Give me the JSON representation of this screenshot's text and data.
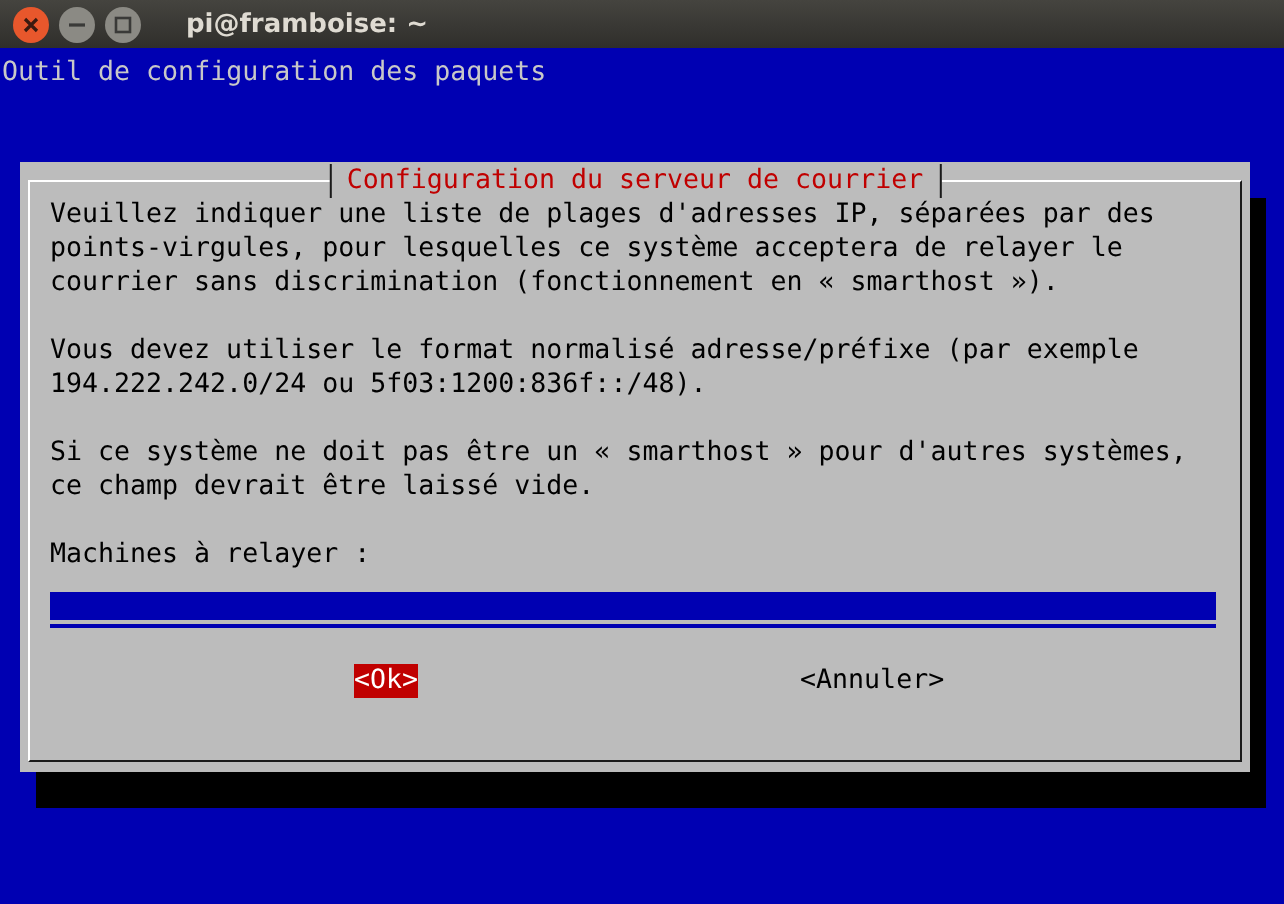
{
  "window": {
    "title": "pi@framboise: ~"
  },
  "header": "Outil de configuration des paquets",
  "dialog": {
    "title": "Configuration du serveur de courrier",
    "paragraphs": [
      [
        "Veuillez indiquer une liste de plages d'adresses IP, séparées par des",
        "points-virgules, pour lesquelles ce système acceptera de relayer le",
        "courrier sans discrimination (fonctionnement en « smarthost »)."
      ],
      [
        "Vous devez utiliser le format normalisé adresse/préfixe (par exemple",
        "194.222.242.0/24 ou 5f03:1200:836f::/48)."
      ],
      [
        "Si ce système ne doit pas être un « smarthost » pour d'autres systèmes,",
        "ce champ devrait être laissé vide."
      ]
    ],
    "field_label": "Machines à relayer :",
    "buttons": [
      {
        "label": "<Ok>",
        "selected": true
      },
      {
        "label": "<Annuler>",
        "selected": false
      }
    ]
  }
}
